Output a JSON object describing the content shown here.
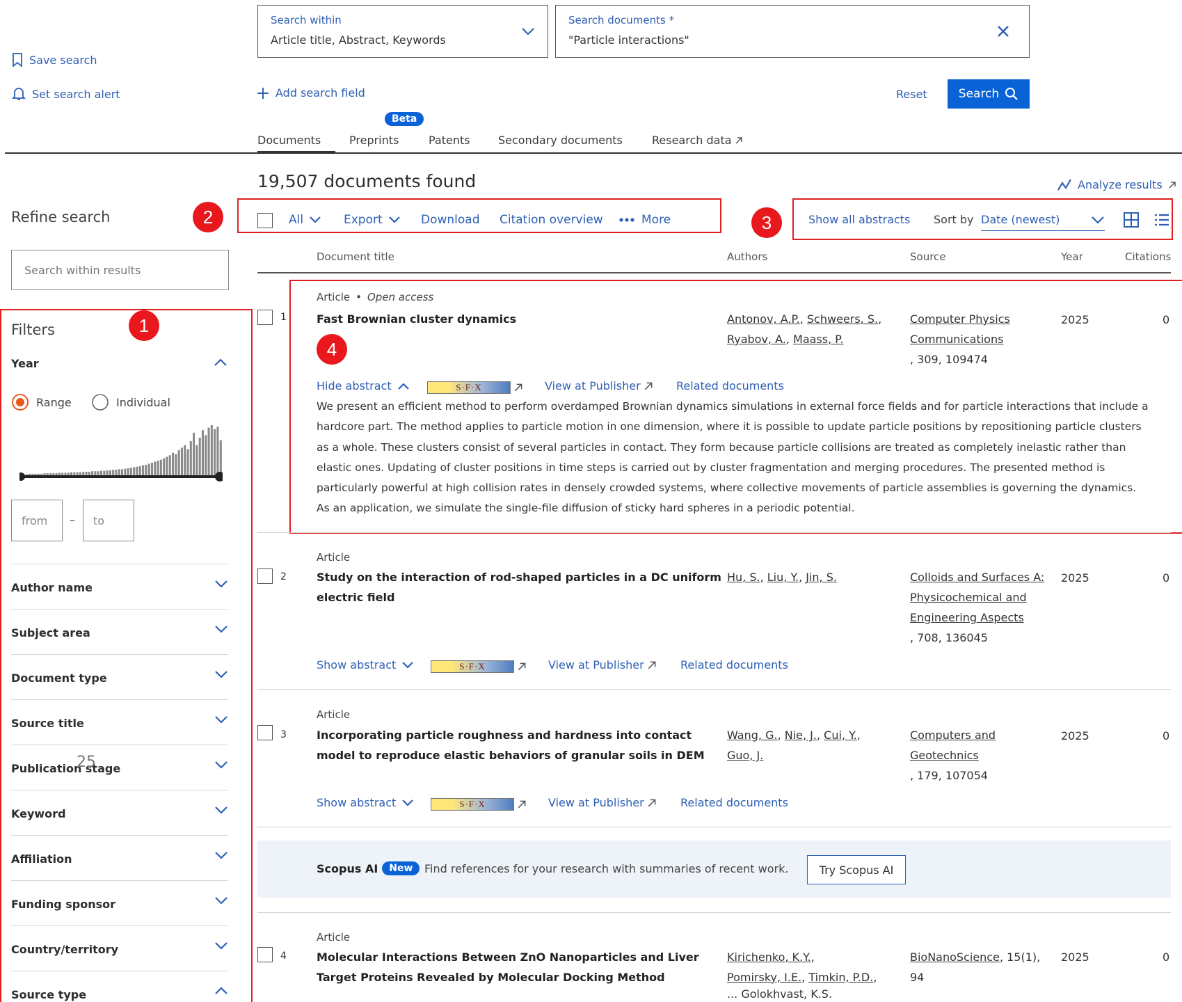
{
  "sidebar_top": {
    "save_search": "Save search",
    "set_alert": "Set search alert"
  },
  "search": {
    "within_label": "Search within",
    "within_value": "Article title, Abstract, Keywords",
    "docs_label": "Search documents *",
    "docs_value": "\"Particle interactions\"",
    "add_field": "Add search field",
    "reset": "Reset",
    "search_button": "Search"
  },
  "tabs": {
    "beta": "Beta",
    "documents": "Documents",
    "preprints": "Preprints",
    "patents": "Patents",
    "secondary": "Secondary documents",
    "research_data": "Research data"
  },
  "results": {
    "count": "19,507 documents found",
    "analyze": "Analyze results"
  },
  "refine": {
    "title": "Refine search",
    "search_placeholder": "Search within results"
  },
  "toolbar": {
    "all": "All",
    "export": "Export",
    "download": "Download",
    "citation": "Citation overview",
    "more": "More",
    "show_abstracts": "Show all abstracts",
    "sort_by": "Sort by",
    "sort_value": "Date (newest)"
  },
  "badges": {
    "b1": "1",
    "b2": "2",
    "b3": "3",
    "b4": "4"
  },
  "filters": {
    "title": "Filters",
    "year": "Year",
    "range": "Range",
    "individual": "Individual",
    "from": "from",
    "to": "to",
    "dash": "–",
    "facets": {
      "author": "Author name",
      "subject": "Subject area",
      "doctype": "Document type",
      "source": "Source title",
      "pubstage": "Publication stage",
      "keyword": "Keyword",
      "affiliation": "Affiliation",
      "funding": "Funding sponsor",
      "country": "Country/territory",
      "sourcetype": "Source type"
    },
    "stray_number": "25"
  },
  "year_histogram": {
    "relative_counts": [
      0.02,
      0.02,
      0.02,
      0.03,
      0.03,
      0.03,
      0.03,
      0.03,
      0.04,
      0.04,
      0.04,
      0.04,
      0.04,
      0.05,
      0.05,
      0.05,
      0.05,
      0.06,
      0.06,
      0.06,
      0.06,
      0.07,
      0.07,
      0.07,
      0.08,
      0.08,
      0.08,
      0.09,
      0.09,
      0.1,
      0.1,
      0.11,
      0.11,
      0.12,
      0.12,
      0.13,
      0.14,
      0.15,
      0.16,
      0.17,
      0.18,
      0.2,
      0.21,
      0.23,
      0.25,
      0.27,
      0.29,
      0.31,
      0.34,
      0.37,
      0.4,
      0.45,
      0.42,
      0.5,
      0.55,
      0.6,
      0.52,
      0.68,
      0.85,
      0.6,
      0.75,
      0.9,
      0.8,
      0.95,
      1.0,
      0.92,
      0.97,
      0.7
    ]
  },
  "columns": {
    "title": "Document title",
    "authors": "Authors",
    "source": "Source",
    "year": "Year",
    "citations": "Citations"
  },
  "row_links": {
    "hide_abstract": "Hide abstract",
    "show_abstract": "Show abstract",
    "sfx": "S·F·X",
    "publisher": "View at Publisher",
    "related": "Related documents"
  },
  "rows": [
    {
      "index": "1",
      "type": "Article",
      "dot": "•",
      "access": "Open access",
      "title": "Fast Brownian cluster dynamics",
      "authors_l1": [
        "Antonov, A.P.",
        "Schweers, S."
      ],
      "authors_l2": [
        "Ryabov, A.",
        "Maass, P."
      ],
      "source_l1": "Computer Physics",
      "source_l2": "Communications",
      "source_l3": ", 309, 109474",
      "year": "2025",
      "citations": "0",
      "abstract": "We present an efficient method to perform overdamped Brownian dynamics simulations in external force fields and for particle interactions that include a hardcore part. The method applies to particle motion in one dimension, where it is possible to update particle positions by repositioning particle clusters as a whole. These clusters consist of several particles in contact. They form because particle collisions are treated as completely inelastic rather than elastic ones. Updating of cluster positions in time steps is carried out by cluster fragmentation and merging procedures. The presented method is particularly powerful at high collision rates in densely crowded systems, where collective movements of particle assemblies is governing the dynamics. As an application, we simulate the single-file diffusion of sticky hard spheres in a periodic potential."
    },
    {
      "index": "2",
      "type": "Article",
      "title_l1": "Study on the interaction of rod-shaped particles in a DC uniform",
      "title_l2": "electric field",
      "authors_l1": [
        "Hu, S.",
        "Liu, Y.",
        "Jin, S."
      ],
      "source_l1": "Colloids and Surfaces A:",
      "source_l2": "Physicochemical and",
      "source_l3": "Engineering Aspects",
      "source_l4": ", 708, 136045",
      "year": "2025",
      "citations": "0"
    },
    {
      "index": "3",
      "type": "Article",
      "title_l1": "Incorporating particle roughness and hardness into contact",
      "title_l2": "model to reproduce elastic behaviors of granular soils in DEM",
      "authors_l1": [
        "Wang, G.",
        "Nie, J.",
        "Cui, Y."
      ],
      "authors_l2": [
        "Guo, J."
      ],
      "source_l1": "Computers and",
      "source_l2": "Geotechnics",
      "source_l3": ", 179, 107054",
      "year": "2025",
      "citations": "0"
    },
    {
      "index": "4",
      "type": "Article",
      "title_l1": "Molecular Interactions Between ZnO Nanoparticles and Liver",
      "title_l2": "Target Proteins Revealed by Molecular Docking Method",
      "authors_l1": [
        "Kirichenko, K.Y."
      ],
      "authors_l2": [
        "Pomirsky, I.E.",
        "Timkin, P.D."
      ],
      "authors_l3": "... Golokhvast, K.S.",
      "source_l1": "BioNanoScience",
      "source_l1b": ", 15(1),",
      "source_l2": "94",
      "year": "2025",
      "citations": "0"
    }
  ],
  "scopus_ai": {
    "label": "Scopus AI",
    "new": "New",
    "text": "Find references for your research with summaries of recent work.",
    "button": "Try Scopus AI"
  },
  "colors": {
    "accent": "#2e5fb3",
    "primary_button": "#0a63d6",
    "annotation_red": "#e02020",
    "radio_orange": "#e85a1a"
  }
}
